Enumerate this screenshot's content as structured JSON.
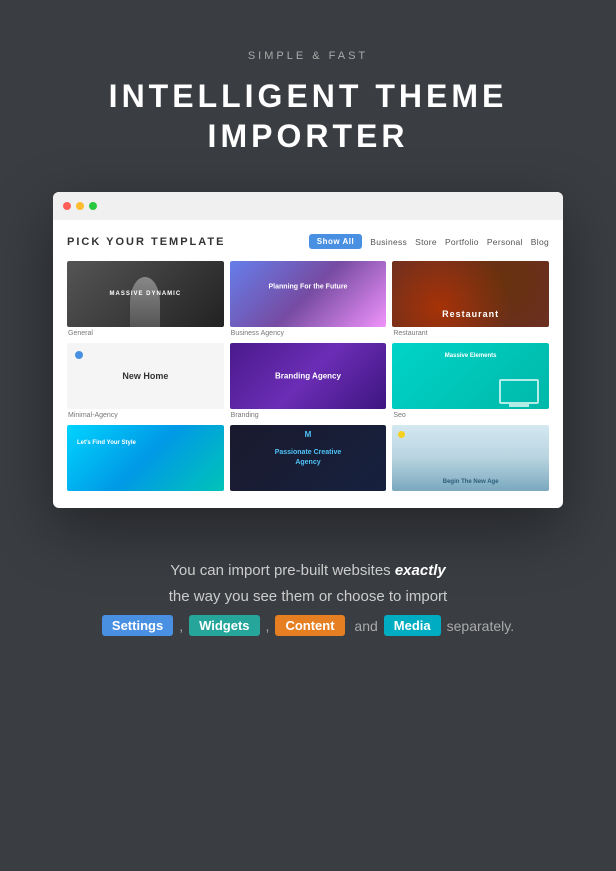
{
  "header": {
    "subtitle": "Simple & Fast",
    "main_title_line1": "Intelligent Theme",
    "main_title_line2": "Importer"
  },
  "browser": {
    "pick_title": "Pick Your Template",
    "show_all": "Show All",
    "nav_links": [
      "Business",
      "Store",
      "Portfolio",
      "Personal",
      "Blog"
    ],
    "templates": [
      {
        "id": 1,
        "label": "General",
        "style": "dark-person"
      },
      {
        "id": 2,
        "label": "Business Agency",
        "style": "gradient-purple"
      },
      {
        "id": 3,
        "label": "Restaurant",
        "style": "dark-food"
      },
      {
        "id": 4,
        "label": "Minimal-Agency",
        "style": "light-home"
      },
      {
        "id": 5,
        "label": "Branding",
        "style": "dark-purple"
      },
      {
        "id": 6,
        "label": "Seo",
        "style": "teal-tech"
      },
      {
        "id": 7,
        "label": "",
        "style": "cyan-mobile"
      },
      {
        "id": 8,
        "label": "",
        "style": "dark-creative"
      },
      {
        "id": 9,
        "label": "",
        "style": "light-arch"
      }
    ]
  },
  "description": {
    "line1": "You can import pre-built websites ",
    "exactly": "exactly",
    "line2": "the way you see them or choose to import",
    "tags": [
      "Settings",
      "Widgets",
      "Content",
      "Media"
    ],
    "separator": ",",
    "end_text": "and",
    "closing": "separately."
  }
}
